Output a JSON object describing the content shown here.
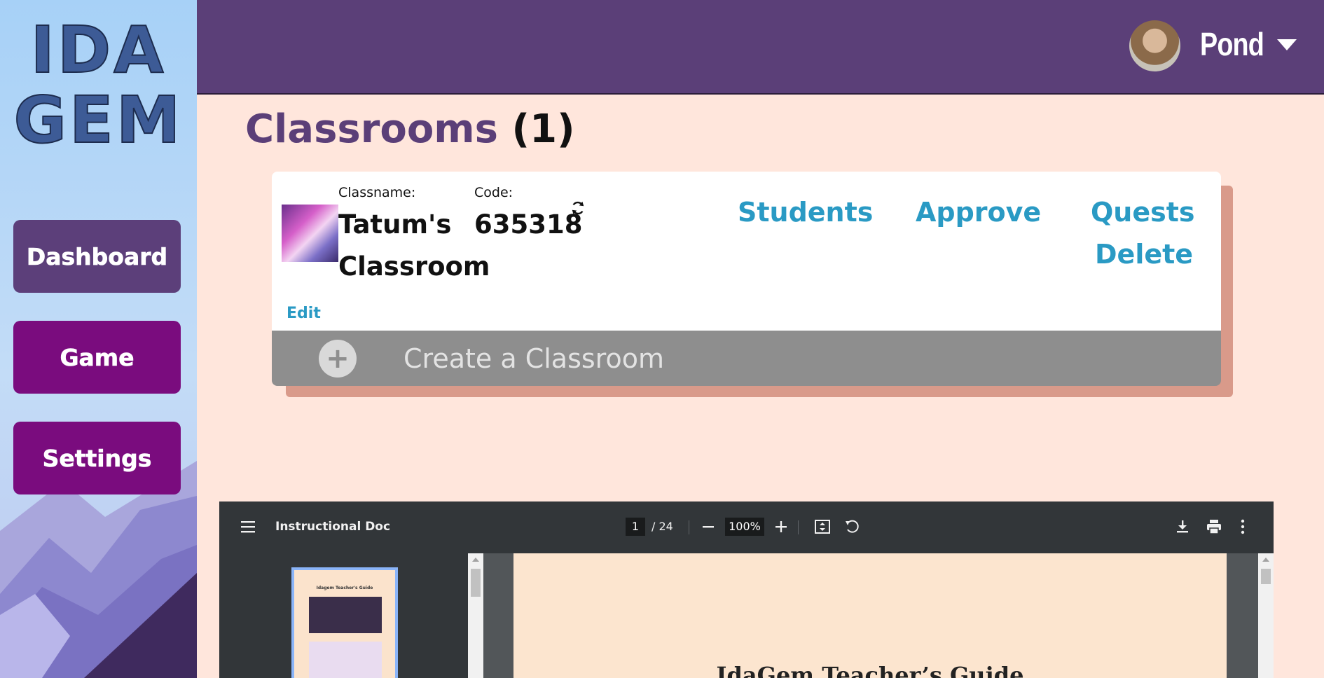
{
  "sidebar": {
    "logo_line1": "IDA",
    "logo_line2": "GEM",
    "items": [
      {
        "label": "Dashboard"
      },
      {
        "label": "Game"
      },
      {
        "label": "Settings"
      }
    ]
  },
  "header": {
    "username": "Pond"
  },
  "page": {
    "title": "Classrooms",
    "count": "(1)"
  },
  "classroom": {
    "classname_label": "Classname:",
    "classname_line1": "Tatum's",
    "classname_line2": "Classroom",
    "code_label": "Code:",
    "code": "635318",
    "actions": {
      "students": "Students",
      "approve": "Approve",
      "quests": "Quests",
      "delete": "Delete"
    },
    "edit": "Edit",
    "create": "Create a Classroom",
    "plus": "+"
  },
  "pdf": {
    "title": "Instructional Doc",
    "page_current": "1",
    "page_total": "/ 24",
    "zoom": "100%",
    "heading": "IdaGem Teacher’s Guide",
    "thumb_title": "Idagem Teacher's Guide"
  },
  "colors": {
    "header": "#5b3f78",
    "dashboard_button": "#5c3f7a",
    "nav_button": "#7a0c7e",
    "link": "#2a9ac4",
    "background": "#ffe6dc"
  }
}
